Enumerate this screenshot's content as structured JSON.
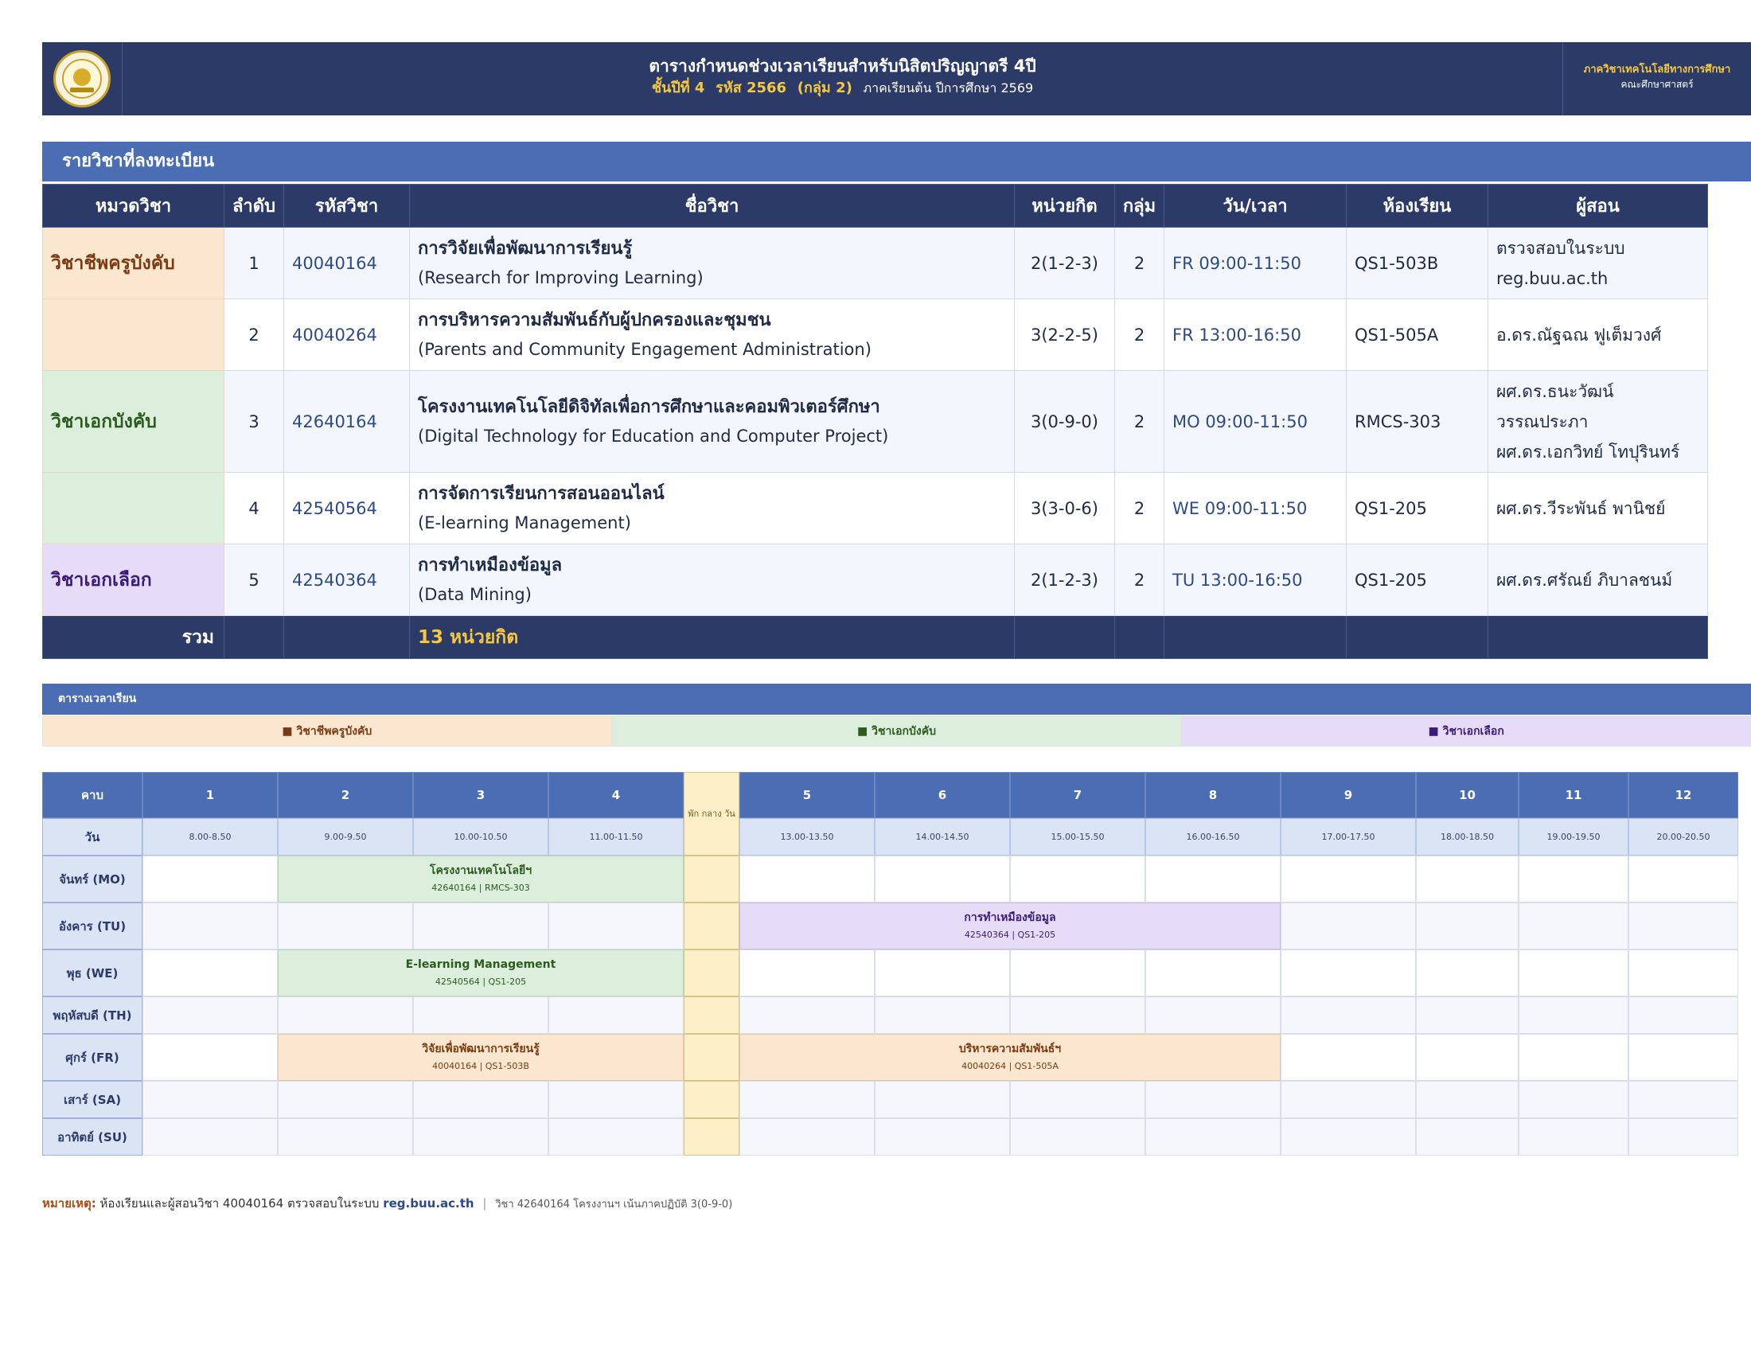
{
  "header": {
    "title": "ตารางกำหนดช่วงเวลาเรียนสำหรับนิสิตปริญญาตรี 4ปี",
    "year_level": "ชั้นปีที่ 4",
    "student_code": "รหัส 2566",
    "group": "(กลุ่ม 2)",
    "semester": "ภาคเรียนต้น ปีการศึกษา 2569",
    "department": "ภาควิชาเทคโนโลยีทางการศึกษา",
    "faculty": "คณะศึกษาศาสตร์"
  },
  "courses_section": {
    "title": "รายวิชาที่ลงทะเบียน",
    "columns": [
      "หมวดวิชา",
      "ลำดับ",
      "รหัสวิชา",
      "ชื่อวิชา",
      "หน่วยกิต",
      "กลุ่ม",
      "วัน/เวลา",
      "ห้องเรียน",
      "ผู้สอน"
    ],
    "categories": [
      {
        "label": "วิชาชีพครูบังคับ",
        "color": "#7a3b12"
      },
      {
        "label": "วิชาเอกบังคับ",
        "color": "#2d5a1f"
      },
      {
        "label": "วิชาเอกเลือก",
        "color": "#3b1b78"
      }
    ],
    "rows": [
      {
        "no": "1",
        "code": "40040164",
        "name_th": "การวิจัยเพื่อพัฒนาการเรียนรู้",
        "name_en": "(Research for Improving Learning)",
        "credits": "2(1-2-3)",
        "group": "2",
        "time": "FR 09:00-11:50",
        "room": "QS1-503B",
        "instructor": [
          "ตรวจสอบในระบบ",
          "reg.buu.ac.th"
        ]
      },
      {
        "no": "2",
        "code": "40040264",
        "name_th": "การบริหารความสัมพันธ์กับผู้ปกครองและชุมชน",
        "name_en": "(Parents and Community Engagement Administration)",
        "credits": "3(2-2-5)",
        "group": "2",
        "time": "FR 13:00-16:50",
        "room": "QS1-505A",
        "instructor": [
          "อ.ดร.ณัฐฉณ ฟูเต็มวงศ์"
        ]
      },
      {
        "no": "3",
        "code": "42640164",
        "name_th": "โครงงานเทคโนโลยีดิจิทัลเพื่อการศึกษาและคอมพิวเตอร์ศึกษา",
        "name_en": "(Digital Technology for Education and Computer Project)",
        "credits": "3(0-9-0)",
        "group": "2",
        "time": "MO 09:00-11:50",
        "room": "RMCS-303",
        "instructor": [
          "ผศ.ดร.ธนะวัฒน์",
          "วรรณประภา",
          "ผศ.ดร.เอกวิทย์ โทปุรินทร์"
        ]
      },
      {
        "no": "4",
        "code": "42540564",
        "name_th": "การจัดการเรียนการสอนออนไลน์",
        "name_en": "(E-learning Management)",
        "credits": "3(3-0-6)",
        "group": "2",
        "time": "WE 09:00-11:50",
        "room": "QS1-205",
        "instructor": [
          "ผศ.ดร.วีระพันธ์ พานิชย์"
        ]
      },
      {
        "no": "5",
        "code": "42540364",
        "name_th": "การทำเหมืองข้อมูล",
        "name_en": "(Data Mining)",
        "credits": "2(1-2-3)",
        "group": "2",
        "time": "TU 13:00-16:50",
        "room": "QS1-205",
        "instructor": [
          "ผศ.ดร.ศรัณย์ ภิบาลชนม์"
        ]
      }
    ],
    "total": {
      "label": "รวม",
      "value": "13  หน่วยกิต"
    }
  },
  "timetable": {
    "title": "ตารางเวลาเรียน",
    "legend": [
      "■  วิชาชีพครูบังคับ",
      "■  วิชาเอกบังคับ",
      "■  วิชาเอกเลือก"
    ],
    "period_label": "คาบ",
    "day_label": "วัน",
    "lunch_label": "พัก กลาง วัน",
    "periods": [
      "1",
      "2",
      "3",
      "4",
      "5",
      "6",
      "7",
      "8",
      "9",
      "10",
      "11",
      "12"
    ],
    "times": [
      "8.00-8.50",
      "9.00-9.50",
      "10.00-10.50",
      "11.00-11.50",
      "13.00-13.50",
      "14.00-14.50",
      "15.00-15.50",
      "16.00-16.50",
      "17.00-17.50",
      "18.00-18.50",
      "19.00-19.50",
      "20.00-20.50"
    ],
    "days": [
      "จันทร์ (MO)",
      "อังคาร (TU)",
      "พุธ (WE)",
      "พฤหัสบดี (TH)",
      "ศุกร์ (FR)",
      "เสาร์ (SA)",
      "อาทิตย์ (SU)"
    ],
    "blocks": [
      {
        "day": 0,
        "start": 2,
        "end": 4,
        "title": "โครงงานเทคโนโลยีฯ",
        "detail": "42640164 | RMCS-303",
        "kind": "maj"
      },
      {
        "day": 1,
        "start": 5,
        "end": 8,
        "title": "การทำเหมืองข้อมูล",
        "detail": "42540364 | QS1-205",
        "kind": "ele"
      },
      {
        "day": 2,
        "start": 2,
        "end": 4,
        "title": "E-learning Management",
        "detail": "42540564 | QS1-205",
        "kind": "maj"
      },
      {
        "day": 4,
        "start": 2,
        "end": 4,
        "title": "วิจัยเพื่อพัฒนาการเรียนรู้",
        "detail": "40040164 | QS1-503B",
        "kind": "prof"
      },
      {
        "day": 4,
        "start": 5,
        "end": 8,
        "title": "บริหารความสัมพันธ์ฯ",
        "detail": "40040264 | QS1-505A",
        "kind": "prof"
      }
    ]
  },
  "note": {
    "label": "หมายเหตุ:",
    "text1": "ห้องเรียนและผู้สอนวิชา 40040164 ตรวจสอบในระบบ",
    "link": "reg.buu.ac.th",
    "separator": "|",
    "text2": "วิชา 42640164 โครงงานฯ เน้นภาคปฏิบัติ 3(0-9-0)"
  },
  "colors": {
    "navy": "#2b3a67",
    "blue": "#4a6db4",
    "gold": "#f5c842",
    "prof_bg": "#fbe6cf",
    "major_bg": "#dcefdc",
    "elective_bg": "#e7dcf8",
    "lunch_bg": "#fdf0c8"
  },
  "icons": {
    "logo": "university-seal-icon"
  }
}
